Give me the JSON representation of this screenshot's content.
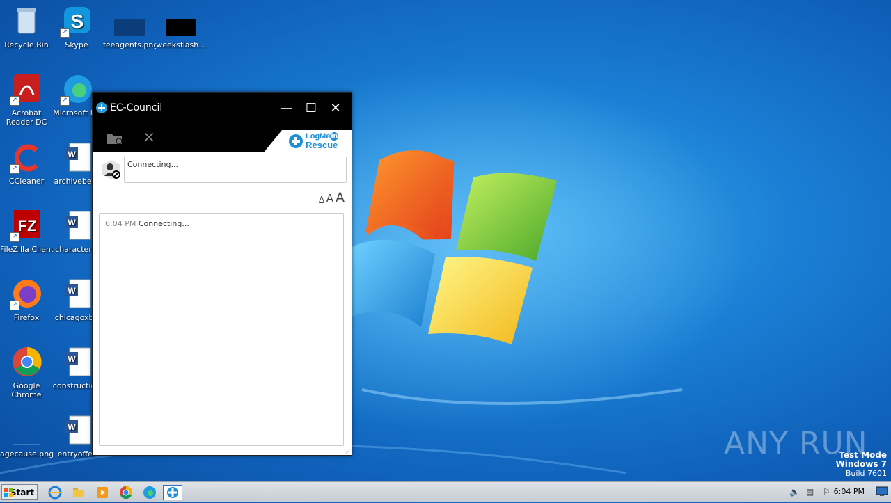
{
  "desktop": {
    "icons": [
      {
        "id": "recycle",
        "label": "Recycle Bin"
      },
      {
        "id": "skype",
        "label": "Skype"
      },
      {
        "id": "feeagents",
        "label": "feeagents.png"
      },
      {
        "id": "weeksflash",
        "label": "weeksflash..."
      },
      {
        "id": "acrobat",
        "label": "Acrobat Reader DC"
      },
      {
        "id": "edge",
        "label": "Microsoft Ed"
      },
      {
        "id": "ccleaner",
        "label": "CCleaner"
      },
      {
        "id": "archivebet",
        "label": "archivebetv"
      },
      {
        "id": "filezilla",
        "label": "FileZilla Client"
      },
      {
        "id": "characterw",
        "label": "characterw"
      },
      {
        "id": "firefox",
        "label": "Firefox"
      },
      {
        "id": "chicagoxbo",
        "label": "chicagoxbo"
      },
      {
        "id": "chrome",
        "label": "Google Chrome"
      },
      {
        "id": "construction",
        "label": "construction"
      },
      {
        "id": "agecause",
        "label": "agecause.png"
      },
      {
        "id": "entryoffer",
        "label": "entryoffer"
      }
    ]
  },
  "window": {
    "title": "EC-Council",
    "minimize_glyph": "—",
    "maximize_glyph": "☐",
    "close_glyph": "✕",
    "brand_top": "LogMe",
    "brand_in": "In",
    "brand_bottom": "Rescue",
    "status_text": "Connecting...",
    "font_size_labels": [
      "A",
      "A",
      "A"
    ],
    "chat": [
      {
        "time": "6:04 PM",
        "text": "Connecting..."
      }
    ]
  },
  "watermark": {
    "text": "ANY RUN"
  },
  "os": {
    "test_mode": "Test Mode",
    "edition": "Windows 7",
    "build": "Build 7601"
  },
  "taskbar": {
    "start_label": "Start",
    "clock": "6:04 PM"
  }
}
